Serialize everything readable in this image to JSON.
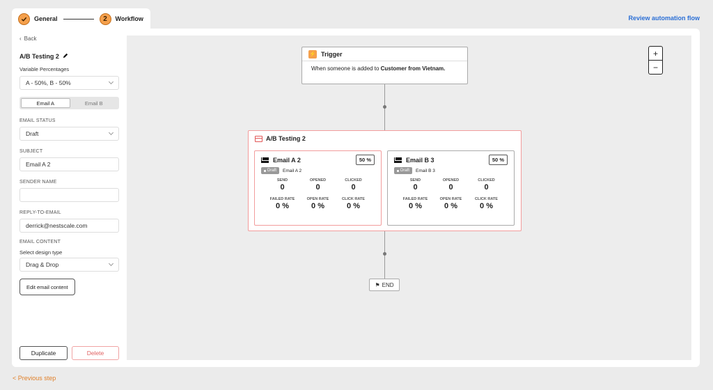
{
  "stepper": {
    "step1_label": "General",
    "step1_icon": "check-icon",
    "step2_number": "2",
    "step2_label": "Workflow"
  },
  "header": {
    "review_link": "Review automation flow"
  },
  "sidebar": {
    "back_label": "Back",
    "title": "A/B Testing 2",
    "variable_percentages_label": "Variable Percentages",
    "variable_percentages_value": "A - 50%, B - 50%",
    "tabs": [
      "Email A",
      "Email B"
    ],
    "active_tab": "Email A",
    "email_status_label": "EMAIL STATUS",
    "email_status_value": "Draft",
    "subject_label": "SUBJECT",
    "subject_value": "Email A 2",
    "sender_name_label": "SENDER NAME",
    "sender_name_value": "",
    "reply_to_label": "REPLY-TO-EMAIL",
    "reply_to_value": "derrick@nestscale.com",
    "email_content_label": "EMAIL CONTENT",
    "design_type_label": "Select design type",
    "design_type_value": "Drag & Drop",
    "edit_content_button": "Edit email content",
    "duplicate_button": "Duplicate",
    "delete_button": "Delete"
  },
  "canvas": {
    "zoom_in": "+",
    "zoom_out": "−",
    "trigger": {
      "title": "Trigger",
      "text_prefix": "When someone is added to ",
      "text_bold": "Customer from Vietnam."
    },
    "ab_test": {
      "title": "A/B Testing 2",
      "emails": [
        {
          "name": "Email A 2",
          "percent": "50 %",
          "status": "Draft",
          "draft_name": "Email A 2",
          "stats": [
            {
              "label": "SEND",
              "value": "0"
            },
            {
              "label": "OPENED",
              "value": "0"
            },
            {
              "label": "CLICKED",
              "value": "0"
            },
            {
              "label": "FAILED RATE",
              "value": "0 %"
            },
            {
              "label": "OPEN RATE",
              "value": "0 %"
            },
            {
              "label": "CLICK RATE",
              "value": "0 %"
            }
          ]
        },
        {
          "name": "Email B 3",
          "percent": "50 %",
          "status": "Draft",
          "draft_name": "Email B 3",
          "stats": [
            {
              "label": "SEND",
              "value": "0"
            },
            {
              "label": "OPENED",
              "value": "0"
            },
            {
              "label": "CLICKED",
              "value": "0"
            },
            {
              "label": "FAILED RATE",
              "value": "0 %"
            },
            {
              "label": "OPEN RATE",
              "value": "0 %"
            },
            {
              "label": "CLICK RATE",
              "value": "0 %"
            }
          ]
        }
      ]
    },
    "end_label": "END"
  },
  "footer": {
    "previous_step": "< Previous step"
  },
  "colors": {
    "accent": "#f5a04c",
    "link": "#2b6fd6",
    "danger": "#e06060",
    "ab_border": "#f29c9c"
  }
}
